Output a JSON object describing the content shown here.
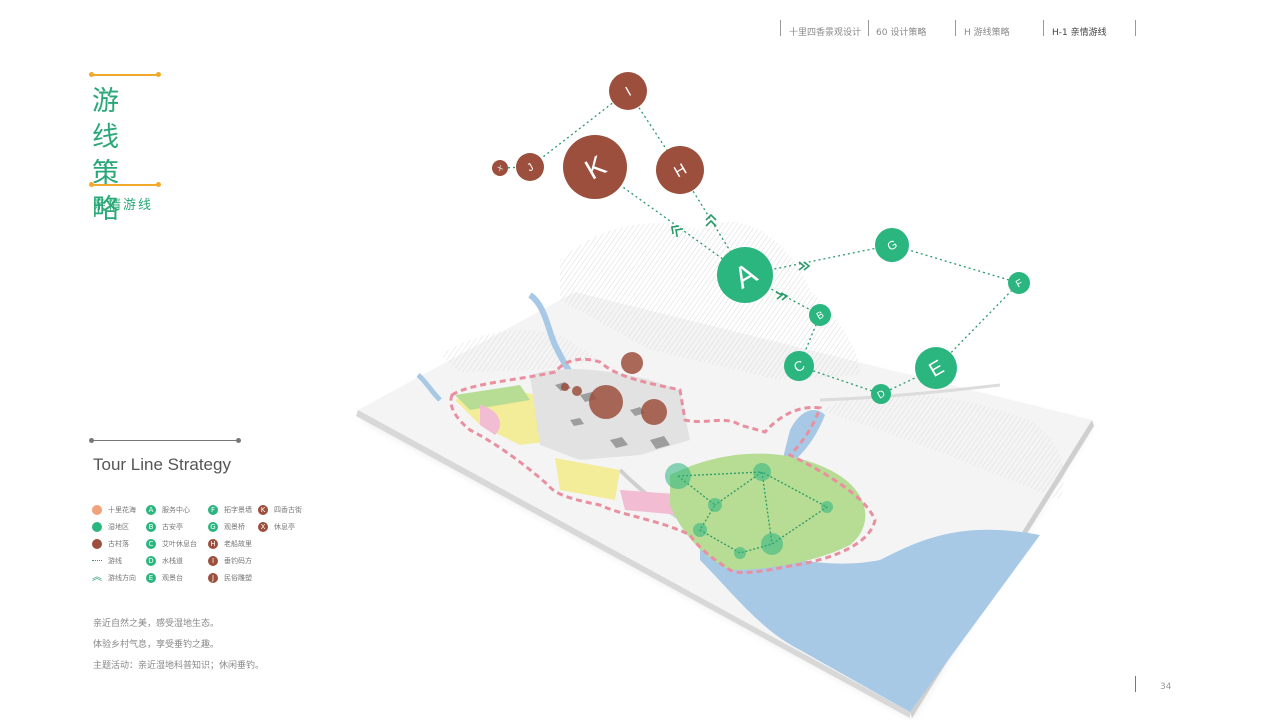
{
  "nav": {
    "items": [
      "十里四香景观设计",
      "60 设计策略",
      "H 游线策略",
      "H-1 亲情游线"
    ],
    "active_index": 3
  },
  "title": {
    "line1": "游 线",
    "line2": "策 略",
    "subtitle": "亲情游线"
  },
  "en_title": "Tour Line Strategy",
  "legend": [
    {
      "symbol": "",
      "label": "十里花海",
      "color": "#f0a27a",
      "icon": "circle"
    },
    {
      "symbol": "A",
      "label": "服务中心",
      "color": "#2bb57f",
      "icon": "circle"
    },
    {
      "symbol": "F",
      "label": "拓字景墙",
      "color": "#2bb57f",
      "icon": "circle"
    },
    {
      "symbol": "K",
      "label": "四香古街",
      "color": "#9b4f3c",
      "icon": "circle"
    },
    {
      "symbol": "",
      "label": "湿地区",
      "color": "#2bb57f",
      "icon": "circle"
    },
    {
      "symbol": "B",
      "label": "古安亭",
      "color": "#2bb57f",
      "icon": "circle"
    },
    {
      "symbol": "G",
      "label": "观景桥",
      "color": "#2bb57f",
      "icon": "circle"
    },
    {
      "symbol": "X",
      "label": "休息亭",
      "color": "#9b4f3c",
      "icon": "circle"
    },
    {
      "symbol": "",
      "label": "古村落",
      "color": "#9b4f3c",
      "icon": "circle"
    },
    {
      "symbol": "C",
      "label": "艾叶休息台",
      "color": "#2bb57f",
      "icon": "circle"
    },
    {
      "symbol": "H",
      "label": "老船故里",
      "color": "#9b4f3c",
      "icon": "circle"
    },
    {
      "symbol": "",
      "label": "游线",
      "color": "#2a9a68",
      "icon": "dotted-line"
    },
    {
      "symbol": "D",
      "label": "水栈道",
      "color": "#2bb57f",
      "icon": "circle"
    },
    {
      "symbol": "I",
      "label": "垂钓码方",
      "color": "#9b4f3c",
      "icon": "circle"
    },
    {
      "symbol": "",
      "label": "游线方向",
      "color": "#2a9a68",
      "icon": "chevron"
    },
    {
      "symbol": "E",
      "label": "观景台",
      "color": "#2bb57f",
      "icon": "circle"
    },
    {
      "symbol": "J",
      "label": "民俗雕塑",
      "color": "#9b4f3c",
      "icon": "circle"
    }
  ],
  "description": [
    "亲近自然之美，感受湿地生态。",
    "体验乡村气息，享受垂钓之趣。",
    "主题活动：亲近湿地科普知识；休闲垂钓。"
  ],
  "page_number": "34",
  "colors": {
    "green": "#2bb57f",
    "brown": "#9b4f3c",
    "orange": "#f0a92a",
    "water": "#a7c9e6"
  },
  "map_nodes": [
    {
      "label": "A",
      "color": "#2bb57f"
    },
    {
      "label": "B",
      "color": "#2bb57f"
    },
    {
      "label": "C",
      "color": "#2bb57f"
    },
    {
      "label": "D",
      "color": "#2bb57f"
    },
    {
      "label": "E",
      "color": "#2bb57f"
    },
    {
      "label": "F",
      "color": "#2bb57f"
    },
    {
      "label": "G",
      "color": "#2bb57f"
    },
    {
      "label": "H",
      "color": "#9b4f3c"
    },
    {
      "label": "I",
      "color": "#9b4f3c"
    },
    {
      "label": "J",
      "color": "#9b4f3c"
    },
    {
      "label": "K",
      "color": "#9b4f3c"
    },
    {
      "label": "X",
      "color": "#9b4f3c"
    }
  ]
}
